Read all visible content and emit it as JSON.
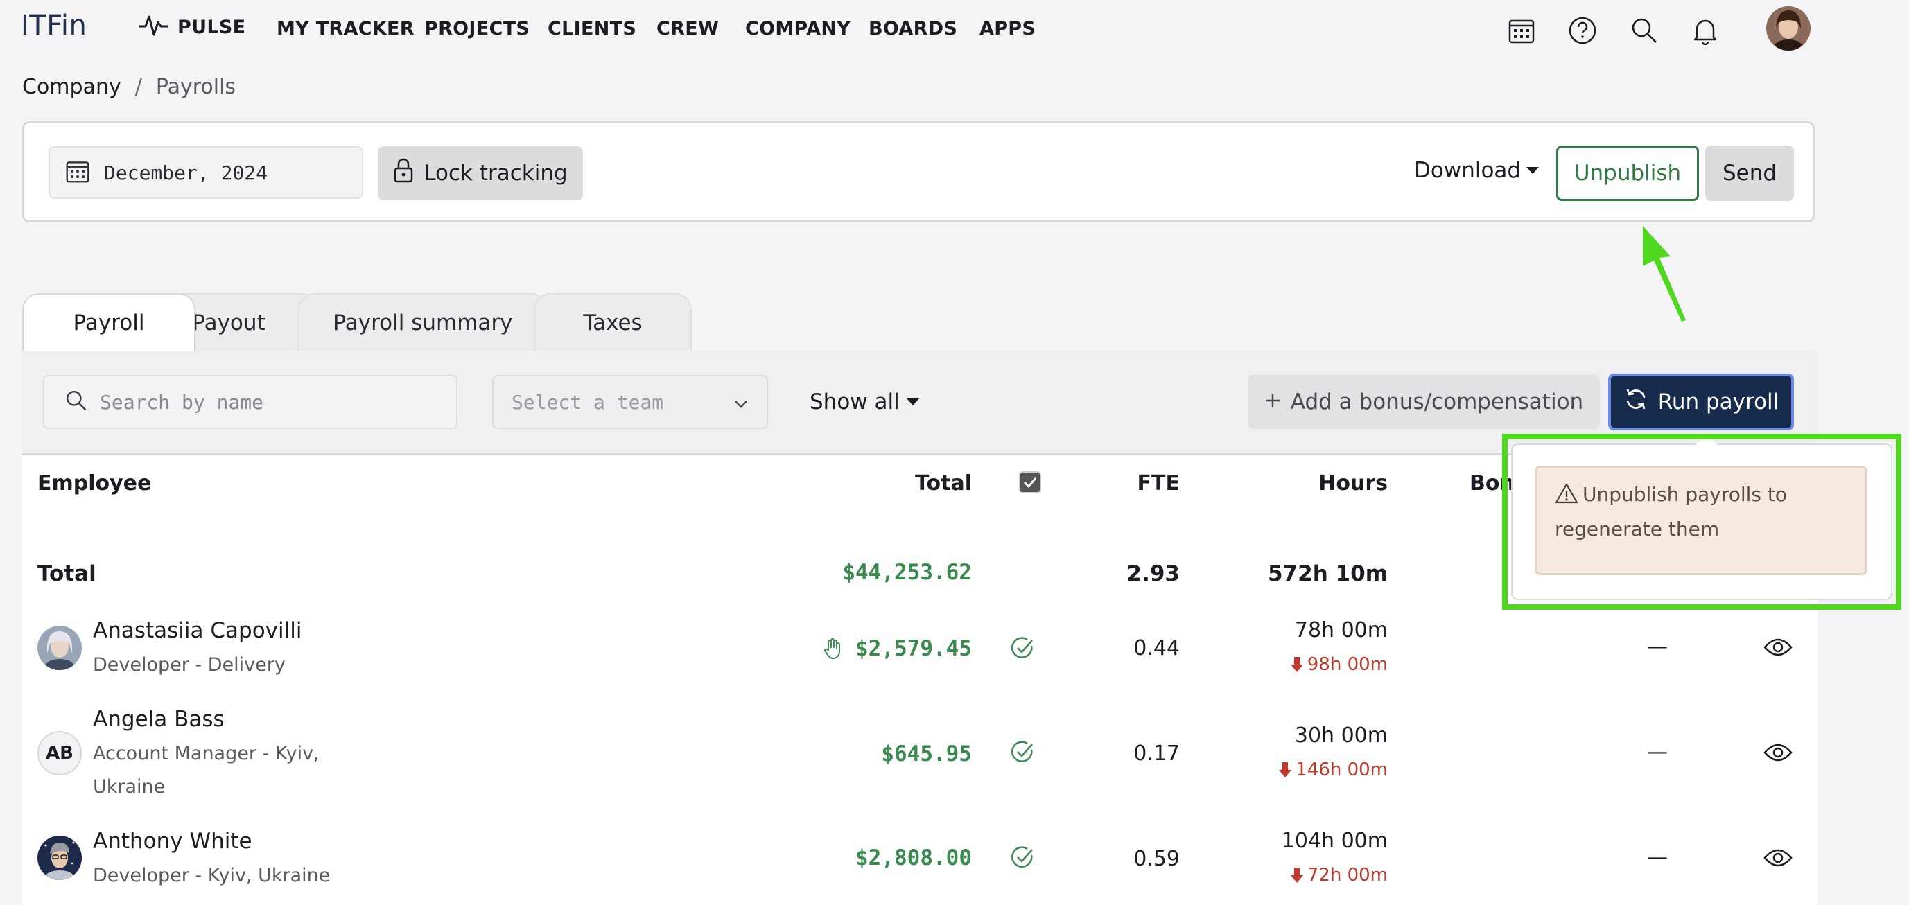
{
  "nav": {
    "logo": "ITFin",
    "items": [
      "PULSE",
      "MY TRACKER",
      "PROJECTS",
      "CLIENTS",
      "CREW",
      "COMPANY",
      "BOARDS",
      "APPS"
    ]
  },
  "breadcrumb": {
    "parent": "Company",
    "separator": "/",
    "current": "Payrolls"
  },
  "toolbar": {
    "date_value": "December, 2024",
    "lock_label": "Lock tracking",
    "download_label": "Download",
    "unpublish_label": "Unpublish",
    "send_label": "Send"
  },
  "tabs": [
    "Payroll",
    "Payout",
    "Payroll summary",
    "Taxes"
  ],
  "filters": {
    "search_placeholder": "Search by name",
    "team_placeholder": "Select a team",
    "show_all_label": "Show all",
    "bonus_label": "Add a bonus/compensation",
    "run_label": "Run payroll"
  },
  "table": {
    "headers": {
      "employee": "Employee",
      "total": "Total",
      "fte": "FTE",
      "hours": "Hours",
      "bonus": "Bonu"
    },
    "total_row": {
      "label": "Total",
      "total": "$44,253.62",
      "fte": "2.93",
      "hours": "572h 10m"
    },
    "rows": [
      {
        "name": "Anastasiia Capovilli",
        "role": "Developer - Delivery",
        "total": "$2,579.45",
        "fte": "0.44",
        "hours": "78h 00m",
        "under": "98h 00m",
        "bonus": "—"
      },
      {
        "name": "Angela Bass",
        "initials": "AB",
        "role_line1": "Account Manager - Kyiv,",
        "role_line2": "Ukraine",
        "total": "$645.95",
        "fte": "0.17",
        "hours": "30h 00m",
        "under": "146h 00m",
        "bonus": "—"
      },
      {
        "name": "Anthony White",
        "role": "Developer - Kyiv, Ukraine",
        "total": "$2,808.00",
        "fte": "0.59",
        "hours": "104h 00m",
        "under": "72h 00m",
        "bonus": "—"
      }
    ]
  },
  "tooltip": {
    "message": "Unpublish payrolls to regenerate them"
  },
  "colors": {
    "accent_green": "#2f7a45",
    "money_green": "#3a8a50",
    "run_button": "#172c4c",
    "highlight": "#4fd81f",
    "arrow": "#4fd81f",
    "under_red": "#c0392b"
  }
}
